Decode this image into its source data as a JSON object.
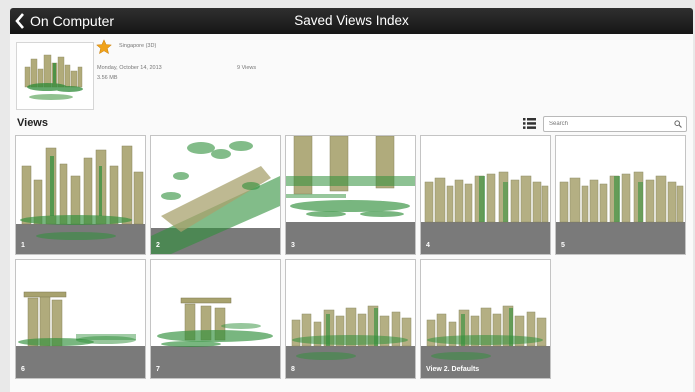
{
  "header": {
    "back_label": "On Computer",
    "title": "Saved Views Index"
  },
  "project": {
    "title": "Singapore (3D)",
    "date": "Monday, October 14, 2013",
    "views_count": "9 Views",
    "size": "3.56 MB",
    "favorite": true
  },
  "views_section": {
    "heading": "Views",
    "search_placeholder": "Search"
  },
  "views": [
    {
      "label": "1",
      "scene": "city-close"
    },
    {
      "label": "2",
      "scene": "aerial-sky"
    },
    {
      "label": "3",
      "scene": "marina-bay"
    },
    {
      "label": "4",
      "scene": "skyline"
    },
    {
      "label": "5",
      "scene": "skyline"
    },
    {
      "label": "6",
      "scene": "marina-bay-side"
    },
    {
      "label": "7",
      "scene": "marina-bay-far"
    },
    {
      "label": "8",
      "scene": "city-street"
    },
    {
      "label": "View 2. Defaults",
      "scene": "city-street"
    }
  ],
  "colors": {
    "titlebar": "#1c1c1c",
    "accent_star": "#f0a21a",
    "building": "#a8a26e",
    "tree": "#2f8f3a",
    "ground": "#7a7a7a"
  }
}
